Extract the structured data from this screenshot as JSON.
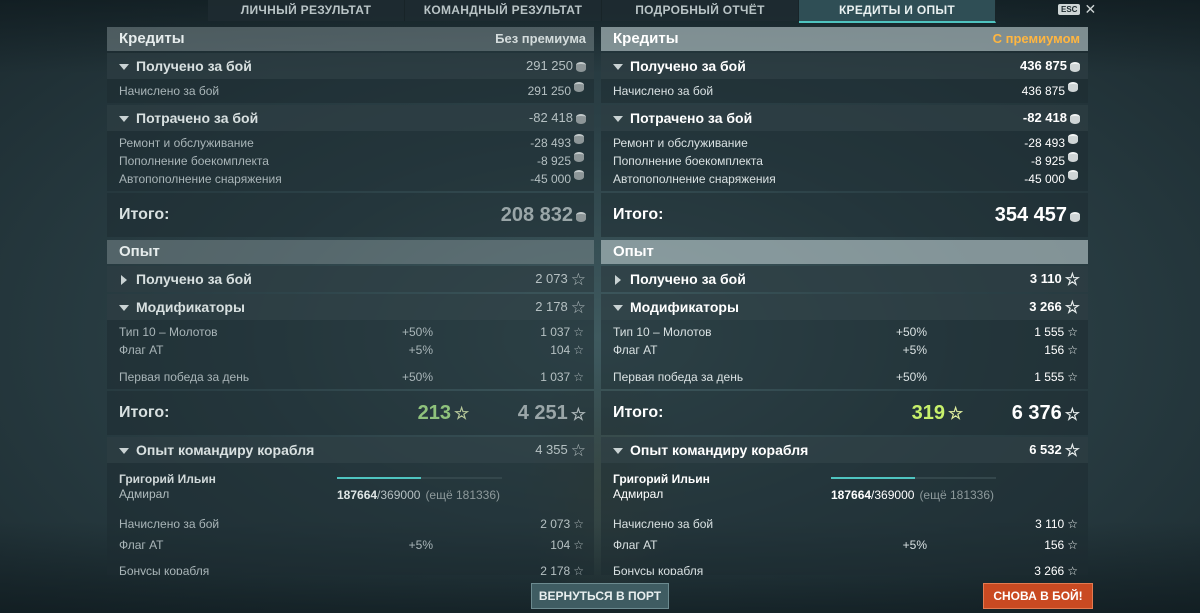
{
  "tabs": [
    "ЛИЧНЫЙ РЕЗУЛЬТАТ",
    "КОМАНДНЫЙ РЕЗУЛЬТАТ",
    "ПОДРОБНЫЙ ОТЧЁТ",
    "КРЕДИТЫ И ОПЫТ"
  ],
  "active_tab": "КРЕДИТЫ И ОПЫТ",
  "esc_label": "ESC",
  "colors": {
    "accent": "#4fc4c0",
    "premium": "#ffb640",
    "battle_button": "#c94a22",
    "bonus_left": "#8fc27c",
    "bonus_right": "#c7f06b"
  },
  "left": {
    "credits_title": "Кредиты",
    "credits_badge": "Без премиума",
    "earned_label": "Получено за бой",
    "earned_value": "291 250",
    "earned_rows": [
      {
        "label": "Начислено за бой",
        "value": "291 250"
      }
    ],
    "spent_label": "Потрачено за бой",
    "spent_value": "-82 418",
    "spent_rows": [
      {
        "label": "Ремонт и обслуживание",
        "value": "-28 493"
      },
      {
        "label": "Пополнение боекомплекта",
        "value": "-8 925"
      },
      {
        "label": "Автопополнение снаряжения",
        "value": "-45 000"
      }
    ],
    "credits_total_label": "Итого:",
    "credits_total": "208 832",
    "xp_title": "Опыт",
    "xp_earned_label": "Получено за бой",
    "xp_earned_value": "2 073",
    "modifiers_label": "Модификаторы",
    "modifiers_value": "2 178",
    "modifier_rows": [
      {
        "label": "Тип 10 – Молотов",
        "pct": "+50%",
        "value": "1 037"
      },
      {
        "label": "Флаг АТ",
        "pct": "+5%",
        "value": "104"
      }
    ],
    "first_win": {
      "label": "Первая победа за день",
      "pct": "+50%",
      "value": "1 037"
    },
    "xp_total_label": "Итого:",
    "xp_bonus": "213",
    "xp_total": "4 251",
    "commander_label": "Опыт командиру корабля",
    "commander_value": "4 355",
    "commander_name": "Григорий Ильин",
    "commander_rank": "Адмирал",
    "commander_xp_current": "187664",
    "commander_xp_max": "/369000",
    "commander_xp_left": "(ещё 181336)",
    "commander_progress": 0.51,
    "commander_rows": [
      {
        "label": "Начислено за бой",
        "pct": "",
        "value": "2 073"
      },
      {
        "label": "Флаг АТ",
        "pct": "+5%",
        "value": "104"
      }
    ],
    "ship_bonus_label": "Бонусы корабля",
    "ship_bonus_value": "2 178"
  },
  "right": {
    "credits_title": "Кредиты",
    "credits_badge": "С премиумом",
    "earned_label": "Получено за бой",
    "earned_value": "436 875",
    "earned_rows": [
      {
        "label": "Начислено за бой",
        "value": "436 875"
      }
    ],
    "spent_label": "Потрачено за бой",
    "spent_value": "-82 418",
    "spent_rows": [
      {
        "label": "Ремонт и обслуживание",
        "value": "-28 493"
      },
      {
        "label": "Пополнение боекомплекта",
        "value": "-8 925"
      },
      {
        "label": "Автопополнение снаряжения",
        "value": "-45 000"
      }
    ],
    "credits_total_label": "Итого:",
    "credits_total": "354 457",
    "xp_title": "Опыт",
    "xp_earned_label": "Получено за бой",
    "xp_earned_value": "3 110",
    "modifiers_label": "Модификаторы",
    "modifiers_value": "3 266",
    "modifier_rows": [
      {
        "label": "Тип 10 – Молотов",
        "pct": "+50%",
        "value": "1 555"
      },
      {
        "label": "Флаг АТ",
        "pct": "+5%",
        "value": "156"
      }
    ],
    "first_win": {
      "label": "Первая победа за день",
      "pct": "+50%",
      "value": "1 555"
    },
    "xp_total_label": "Итого:",
    "xp_bonus": "319",
    "xp_total": "6 376",
    "commander_label": "Опыт командиру корабля",
    "commander_value": "6 532",
    "commander_name": "Григорий Ильин",
    "commander_rank": "Адмирал",
    "commander_xp_current": "187664",
    "commander_xp_max": "/369000",
    "commander_xp_left": "(ещё 181336)",
    "commander_progress": 0.51,
    "commander_rows": [
      {
        "label": "Начислено за бой",
        "pct": "",
        "value": "3 110"
      },
      {
        "label": "Флаг АТ",
        "pct": "+5%",
        "value": "156"
      }
    ],
    "ship_bonus_label": "Бонусы корабля",
    "ship_bonus_value": "3 266"
  },
  "buttons": {
    "port": "ВЕРНУТЬСЯ В ПОРТ",
    "battle": "СНОВА В БОЙ!"
  }
}
